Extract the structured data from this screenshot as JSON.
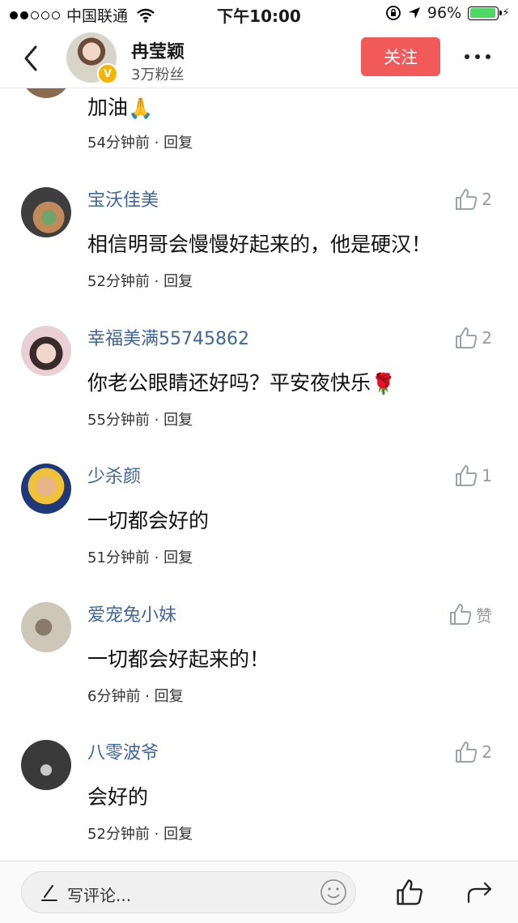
{
  "status_bar": {
    "carrier": "中国联通",
    "time": "下午10:00",
    "battery": "96%",
    "battery_level": 0.96
  },
  "header": {
    "name": "冉莹颖",
    "fans": "3万粉丝",
    "follow_label": "关注"
  },
  "comments": [
    {
      "user": "",
      "text": "加油",
      "emoji": "🙏",
      "time": "54分钟前",
      "reply": "回复",
      "likes": ""
    },
    {
      "user": "宝沃佳美",
      "text": "相信明哥会慢慢好起来的，他是硬汉！",
      "emoji": "",
      "time": "52分钟前",
      "reply": "回复",
      "likes": "2"
    },
    {
      "user": "幸福美满55745862",
      "text": "你老公眼睛还好吗？平安夜快乐",
      "emoji": "🌹",
      "time": "55分钟前",
      "reply": "回复",
      "likes": "2"
    },
    {
      "user": "少杀颜",
      "text": "一切都会好的",
      "emoji": "",
      "time": "51分钟前",
      "reply": "回复",
      "likes": "1"
    },
    {
      "user": "爱宠兔小妹",
      "text": "一切都会好起来的！",
      "emoji": "",
      "time": "6分钟前",
      "reply": "回复",
      "likes": "赞"
    },
    {
      "user": "八零波爷",
      "text": "会好的",
      "emoji": "",
      "time": "52分钟前",
      "reply": "回复",
      "likes": "2"
    }
  ],
  "meta_separator": " · ",
  "bottom_bar": {
    "placeholder": "写评论..."
  },
  "icons": {
    "back": "back-icon",
    "more": "more-icon",
    "like": "thumbs-up-icon",
    "pen": "pen-icon",
    "emoji": "smiley-icon",
    "share": "share-icon"
  },
  "colors": {
    "follow_button": "#f25a5a",
    "username": "#406599",
    "battery": "#4cd964",
    "verified_badge": "#f5b400"
  }
}
